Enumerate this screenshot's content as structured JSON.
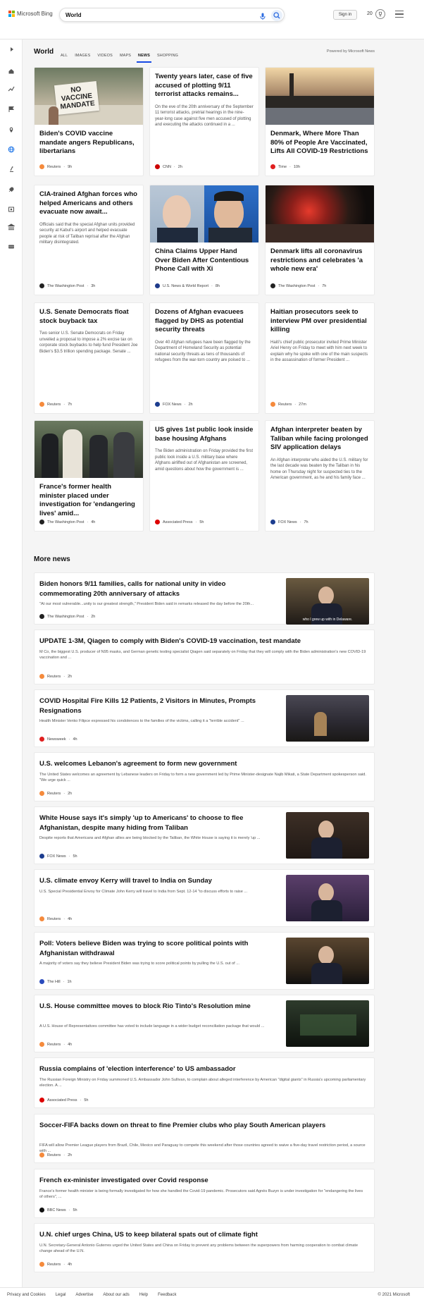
{
  "header": {
    "logo_text": "Microsoft Bing",
    "search_value": "World",
    "signin_label": "Sign in",
    "points": "20"
  },
  "nav": {
    "tabs": [
      "ALL",
      "IMAGES",
      "VIDEOS",
      "MAPS",
      "NEWS",
      "SHOPPING"
    ],
    "active": "NEWS"
  },
  "sidebar": {
    "icons": [
      "expand-icon",
      "home-icon",
      "trending-icon",
      "flag-icon",
      "location-icon",
      "globe-icon",
      "microscope-icon",
      "rocket-icon",
      "entertainment-icon",
      "bank-icon",
      "sports-icon"
    ]
  },
  "world": {
    "title": "World",
    "powered": "Powered by Microsoft News",
    "cards": [
      {
        "title": "Biden's COVID vaccine mandate angers Republicans, libertarians",
        "desc": "",
        "source": "Reuters",
        "time": "9h",
        "icon_color": "#f58a3c",
        "image": "sign-photo"
      },
      {
        "title": "Twenty years later, case of five accused of plotting 9/11 terrorist attacks remains...",
        "desc": "On the eve of the 20th anniversary of the September 11 terrorist attacks, pretrial hearings in the nine-year-long case against five men accused of plotting and executing the attacks continued in a ...",
        "source": "CNN",
        "time": "2h",
        "icon_color": "#cc0000",
        "image": ""
      },
      {
        "title": "Denmark, Where More Than 80% of People Are Vaccinated, Lifts All COVID-19 Restrictions",
        "desc": "",
        "source": "Time",
        "time": "10h",
        "icon_color": "#e01f1f",
        "image": "city-photo"
      },
      {
        "title": "CIA-trained Afghan forces who helped Americans and others evacuate now await...",
        "desc": "Officials said that the special Afghan units provided security at Kabul's airport and helped evacuate people at risk of Taliban reprisal after the Afghan military disintegrated.",
        "source": "The Washington Post",
        "time": "3h",
        "icon_color": "#222",
        "image": ""
      },
      {
        "title": "China Claims Upper Hand Over Biden After Contentious Phone Call with Xi",
        "desc": "",
        "source": "U.S. News & World Report",
        "time": "8h",
        "icon_color": "#1e3a8a",
        "image": "leaders-photo"
      },
      {
        "title": "Denmark lifts all coronavirus restrictions and celebrates 'a whole new era'",
        "desc": "",
        "source": "The Washington Post",
        "time": "7h",
        "icon_color": "#222",
        "image": "night-photo"
      },
      {
        "title": "U.S. Senate Democrats float stock buyback tax",
        "desc": "Two senior U.S. Senate Democrats on Friday unveiled a proposal to impose a 2% excise tax on corporate stock buybacks to help fund President Joe Biden's $3.5 trillion spending package. Senate ...",
        "source": "Reuters",
        "time": "7h",
        "icon_color": "#f58a3c",
        "image": ""
      },
      {
        "title": "Dozens of Afghan evacuees flagged by DHS as potential security threats",
        "desc": "Over 40 Afghan refugees have been flagged by the Department of Homeland Security as potential national security threats as tens of thousands of refugees from the war-torn country are poised to ...",
        "source": "FOX News",
        "time": "2h",
        "icon_color": "#1c3d8f",
        "image": ""
      },
      {
        "title": "Haitian prosecutors seek to interview PM over presidential killing",
        "desc": "Haiti's chief public prosecutor invited Prime Minister Ariel Henry on Friday to meet with him next week to explain why he spoke with one of the main suspects in the assassination of former President ...",
        "source": "Reuters",
        "time": "27m",
        "icon_color": "#f58a3c",
        "image": ""
      },
      {
        "title": "France's former health minister placed under investigation for 'endangering lives' amid...",
        "desc": "",
        "source": "The Washington Post",
        "time": "4h",
        "icon_color": "#222",
        "image": "crowd-photo"
      },
      {
        "title": "US gives 1st public look inside base housing Afghans",
        "desc": "The Biden administration on Friday provided the first public look inside a U.S. military base where Afghans airlifted out of Afghanistan are screened, amid questions about how the government is ...",
        "source": "Associated Press",
        "time": "5h",
        "icon_color": "#d00",
        "image": ""
      },
      {
        "title": "Afghan interpreter beaten by Taliban while facing prolonged SIV application delays",
        "desc": "An Afghan interpreter who aided the U.S. military for the last decade was beaten by the Taliban in his home on Thursday night for suspected ties to the American government, as he and his family face ...",
        "source": "FOX News",
        "time": "7h",
        "icon_color": "#1c3d8f",
        "image": ""
      }
    ]
  },
  "more_news": {
    "title": "More news",
    "items": [
      {
        "title": "Biden honors 9/11 families, calls for national unity in video commemorating 20th anniversary of attacks",
        "desc": "\"At our most vulnerable...unity is our greatest strength,\" President Biden said in remarks released the day before the 20th...",
        "source": "The Washington Post",
        "time": "2h",
        "icon_color": "#222",
        "thumb": "video",
        "caption": "who I grew up with in Delaware."
      },
      {
        "title": "UPDATE 1-3M, Qiagen to comply with Biden's COVID-19 vaccination, test mandate",
        "desc": "M Co, the biggest U.S. producer of N95 masks, and German genetic testing specialist Qiagen said separately on Friday that they will comply with the Biden administration's new COVID-19 vaccination and ...",
        "source": "Reuters",
        "time": "2h",
        "icon_color": "#f58a3c",
        "thumb": "",
        "caption": ""
      },
      {
        "title": "COVID Hospital Fire Kills 12 Patients, 2 Visitors in Minutes, Prompts Resignations",
        "desc": "Health Minister Venko Filipce expressed his condolences to the families of the victims, calling it a \"terrible accident\" ...",
        "source": "Newsweek",
        "time": "4h",
        "icon_color": "#e02020",
        "thumb": "fire",
        "caption": ""
      },
      {
        "title": "U.S. welcomes Lebanon's agreement to form new government",
        "desc": "The United States welcomes an agreement by Lebanese leaders on Friday to form a new government led by Prime Minister-designate Najib Mikati, a State Department spokesperson said. \"We urge quick ...",
        "source": "Reuters",
        "time": "2h",
        "icon_color": "#f58a3c",
        "thumb": "",
        "caption": ""
      },
      {
        "title": "White House says it's simply 'up to Americans' to choose to flee Afghanistan, despite many hiding from Taliban",
        "desc": "Despite reports that Americans and Afghan allies are being blocked by the Taliban, the White House is saying it is merely 'up ...",
        "source": "FOX News",
        "time": "5h",
        "icon_color": "#1c3d8f",
        "thumb": "biden",
        "caption": ""
      },
      {
        "title": "U.S. climate envoy Kerry will travel to India on Sunday",
        "desc": "U.S. Special Presidential Envoy for Climate John Kerry will travel to India from Sept. 12-14 \"to discuss efforts to raise ...",
        "source": "Reuters",
        "time": "4h",
        "icon_color": "#f58a3c",
        "thumb": "kerry",
        "caption": ""
      },
      {
        "title": "Poll: Voters believe Biden was trying to score political points with Afghanistan withdrawal",
        "desc": "A majority of voters say they believe President Biden was trying to score political points by pulling the U.S. out of ...",
        "source": "The Hill",
        "time": "1h",
        "icon_color": "#2a4bbd",
        "thumb": "podium",
        "caption": ""
      },
      {
        "title": "U.S. House committee moves to block Rio Tinto's Resolution mine",
        "desc": "A U.S. House of Representatives committee has voted to include language in a wider budget reconciliation package that would ...",
        "source": "Reuters",
        "time": "4h",
        "icon_color": "#f58a3c",
        "thumb": "mine",
        "caption": ""
      },
      {
        "title": "Russia complains of 'election interference' to US ambassador",
        "desc": "The Russian Foreign Ministry on Friday summoned U.S. Ambassador John Sullivan, to complain about alleged interference by American \"digital giants\" in Russia's upcoming parliamentary election. A ...",
        "source": "Associated Press",
        "time": "5h",
        "icon_color": "#d00",
        "thumb": "",
        "caption": ""
      },
      {
        "title": "Soccer-FIFA backs down on threat to fine Premier clubs who play South American players",
        "desc": "FIFA will allow Premier League players from Brazil, Chile, Mexico and Paraguay to compete this weekend after those countries agreed to waive a five-day travel restriction period, a source with ...",
        "source": "Reuters",
        "time": "2h",
        "icon_color": "#f58a3c",
        "thumb": "",
        "caption": ""
      },
      {
        "title": "French ex-minister investigated over Covid response",
        "desc": "France's former health minister is being formally investigated for how she handled the Covid-19 pandemic. Prosecutors said Agnès Buzyn is under investigation for \"endangering the lives of others\", ...",
        "source": "BBC News",
        "time": "5h",
        "icon_color": "#111",
        "thumb": "",
        "caption": ""
      },
      {
        "title": "U.N. chief urges China, US to keep bilateral spats out of climate fight",
        "desc": "U.N. Secretary-General Antonio Guterres urged the United States and China on Friday to prevent any problems between the superpowers from harming cooperation to combat climate change ahead of the U.N.",
        "source": "Reuters",
        "time": "4h",
        "icon_color": "#f58a3c",
        "thumb": "",
        "caption": ""
      }
    ]
  },
  "footer": {
    "links": [
      "Privacy and Cookies",
      "Legal",
      "Advertise",
      "About our ads",
      "Help",
      "Feedback"
    ],
    "copyright": "© 2021 Microsoft"
  }
}
